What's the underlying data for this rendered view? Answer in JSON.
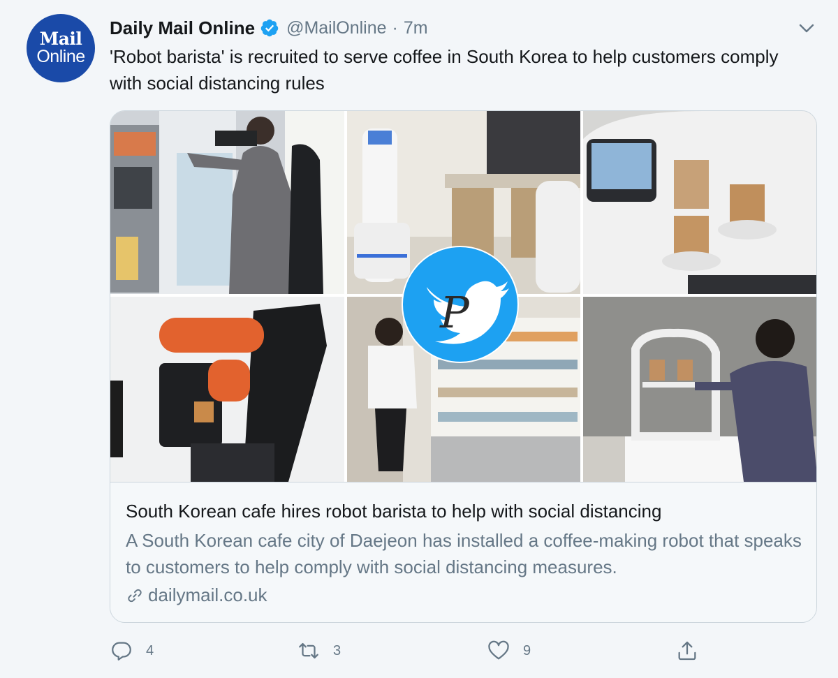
{
  "account": {
    "avatar_line1": "Mail",
    "avatar_line2": "Online",
    "display_name": "Daily Mail Online",
    "handle": "@MailOnline",
    "separator": "·",
    "time": "7m"
  },
  "tweet": {
    "text": "'Robot barista' is recruited to serve coffee in South Korea to help customers comply with social distancing rules"
  },
  "watermark": {
    "letter": "P"
  },
  "card": {
    "title": "South Korean cafe hires robot barista to help with social distancing",
    "description": "A South Korean cafe city of Daejeon has installed a coffee-making robot that speaks to customers to help comply with social distancing measures.",
    "domain": "dailymail.co.uk"
  },
  "actions": {
    "reply_count": "4",
    "retweet_count": "3",
    "like_count": "9"
  },
  "colors": {
    "twitter_blue": "#1da1f2",
    "mail_blue": "#1a4aa8",
    "secondary_text": "#657786"
  }
}
